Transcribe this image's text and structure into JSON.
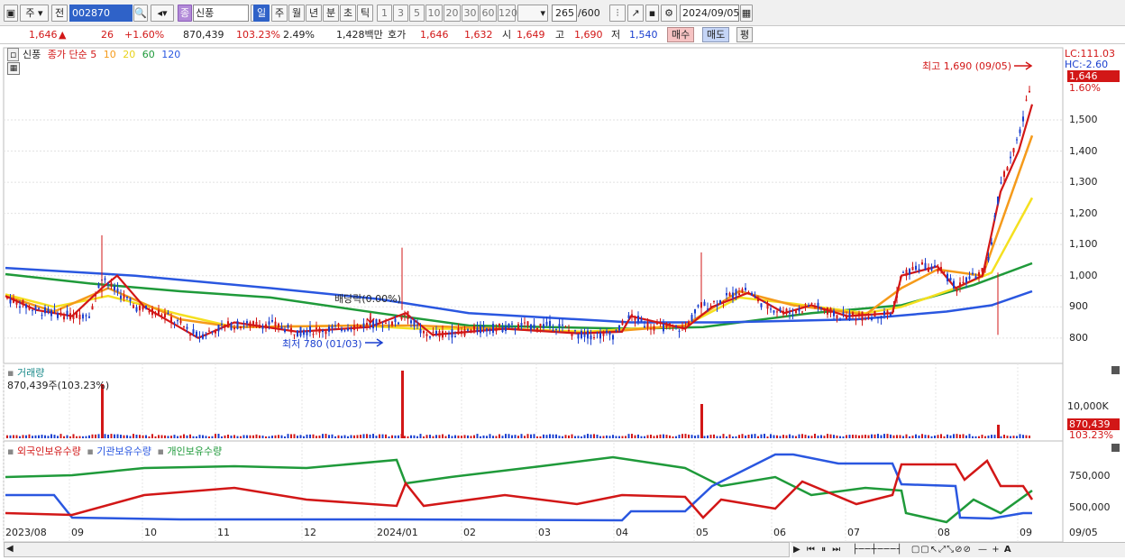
{
  "toolbar": {
    "market_label": "주",
    "prev_label": "전",
    "stock_code": "002870",
    "stock_name_prefix": "종",
    "stock_name": "신풍",
    "periods": [
      "일",
      "주",
      "월",
      "년",
      "분",
      "초",
      "틱"
    ],
    "active_period": "일",
    "intervals": [
      "1",
      "3",
      "5",
      "10",
      "20",
      "30",
      "60",
      "120"
    ],
    "count_value": "265",
    "count_max": "/600",
    "date": "2024/09/05"
  },
  "info": {
    "price": "1,646",
    "arrow": "▲",
    "change": "26",
    "change_pct": "+1.60%",
    "volume": "870,439",
    "volume_ratio": "103.23%",
    "turnover": "2.49%",
    "amount": "1,428백만",
    "quote_label": "호가",
    "ask": "1,646",
    "bid": "1,632",
    "open_label": "시",
    "open": "1,649",
    "high_label": "고",
    "high": "1,690",
    "low_label": "저",
    "low": "1,540",
    "buy_label": "매수",
    "sell_label": "매도",
    "avg_label": "평"
  },
  "price_panel": {
    "name": "신풍",
    "price_type": "종가 단순",
    "ma_periods": [
      "5",
      "10",
      "20",
      "60",
      "120"
    ],
    "ma_colors": [
      "#d21717",
      "#f59a1a",
      "#f5e020",
      "#1f9a3a",
      "#2a57e0"
    ],
    "lc_label": "LC:111.03",
    "hc_label": "HC:-2.60",
    "current_tag": "1,646",
    "current_pct_tag": "1.60%",
    "high_annotation": "최고 1,690 (09/05)",
    "low_annotation": "최저 780 (01/03)",
    "dividend_annotation": "배당락(0.00%)",
    "y_ticks": [
      "1,500",
      "1,400",
      "1,300",
      "1,200",
      "1,100",
      "1,000",
      "900",
      "800"
    ],
    "y_range": [
      730,
      1720
    ]
  },
  "volume_panel": {
    "title": "거래량",
    "value_label": "870,439주(103.23%)",
    "y_tick": "10,000K",
    "current_tag": "870,439",
    "current_pct_tag": "103.23%"
  },
  "holding_panel": {
    "legend": [
      {
        "label": "외국인보유수량",
        "color": "#d21717"
      },
      {
        "label": "기관보유수량",
        "color": "#2a57e0"
      },
      {
        "label": "개인보유수량",
        "color": "#1f9a3a"
      }
    ],
    "y_ticks": [
      "750,000",
      "500,000"
    ]
  },
  "x_axis": [
    "2023/08",
    "09",
    "10",
    "11",
    "12",
    "2024/01",
    "02",
    "03",
    "04",
    "05",
    "06",
    "07",
    "08",
    "09"
  ],
  "x_axis_right": "09/05",
  "bottom_icons": [
    "play-icon",
    "rewind-icon",
    "pause-icon",
    "fast-forward-icon"
  ],
  "zoom_icons": [
    "minus-icon",
    "plus-icon",
    "font-size-icon"
  ],
  "zoom_letter": "A"
}
